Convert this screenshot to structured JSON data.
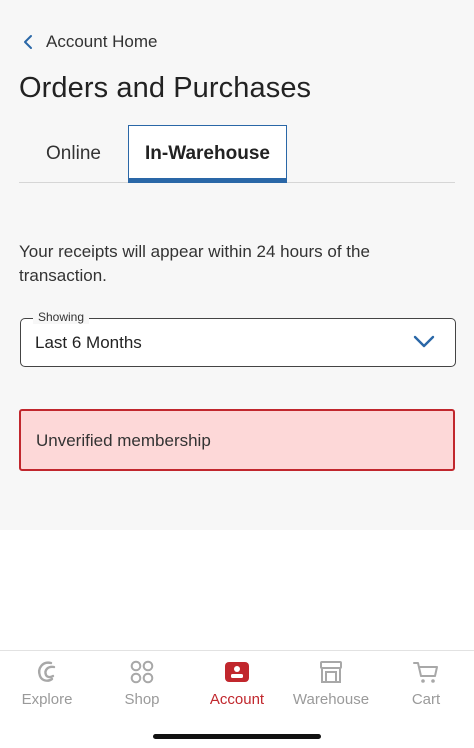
{
  "header": {
    "back_label": "Account Home",
    "title": "Orders and Purchases"
  },
  "tabs": [
    {
      "label": "Online",
      "selected": false
    },
    {
      "label": "In-Warehouse",
      "selected": true
    }
  ],
  "info": {
    "text": "Your receipts will appear within 24 hours of the transaction."
  },
  "filter": {
    "legend": "Showing",
    "value": "Last 6 Months"
  },
  "alert": {
    "message": "Unverified membership"
  },
  "bottom_nav": {
    "items": [
      {
        "label": "Explore",
        "icon": "explore-icon",
        "active": false
      },
      {
        "label": "Shop",
        "icon": "shop-grid-icon",
        "active": false
      },
      {
        "label": "Account",
        "icon": "account-icon",
        "active": true
      },
      {
        "label": "Warehouse",
        "icon": "warehouse-icon",
        "active": false
      },
      {
        "label": "Cart",
        "icon": "cart-icon",
        "active": false
      }
    ]
  },
  "colors": {
    "accent_blue": "#2a67a7",
    "accent_red": "#c1272d",
    "alert_bg": "#fdd8d8",
    "inactive_gray": "#9a9a9a"
  }
}
